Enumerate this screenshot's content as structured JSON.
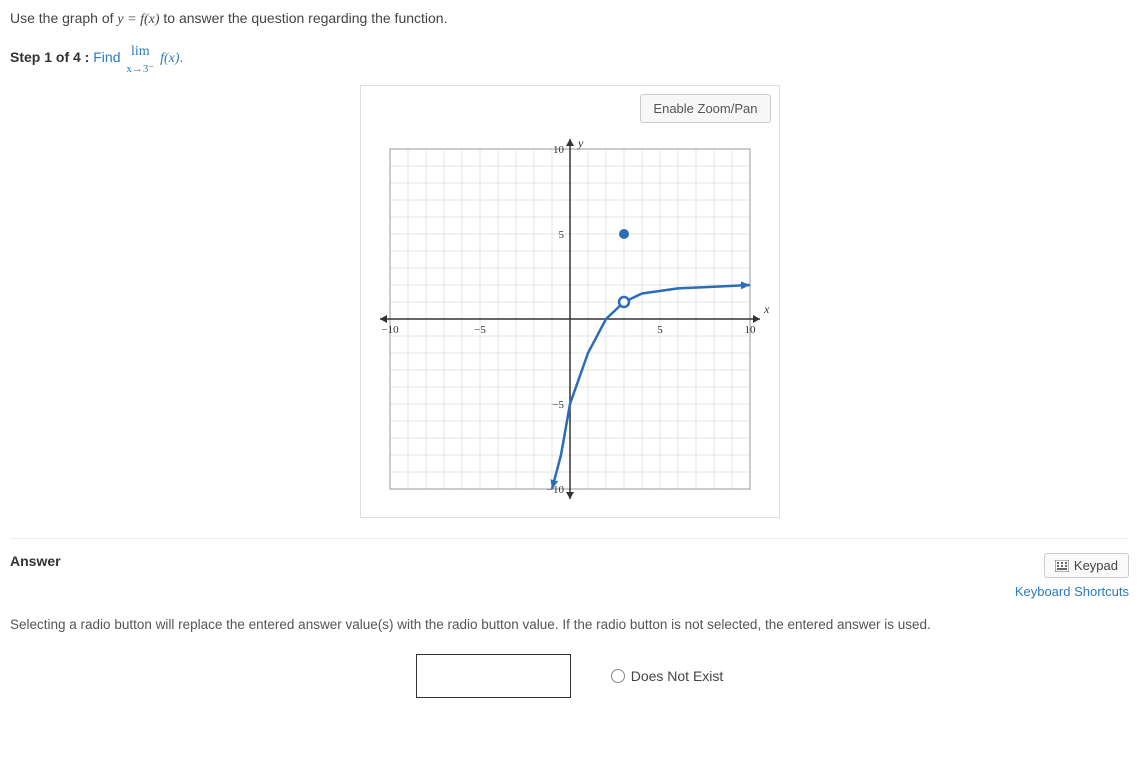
{
  "instruction": {
    "prefix": "Use the graph of ",
    "eq_lhs": "y",
    "eq_mid": " = ",
    "eq_rhs": "f(x)",
    "suffix": " to answer the question regarding the function."
  },
  "step": {
    "label": "Step 1 of 4 :",
    "task_prefix": "Find ",
    "limit_top": "lim",
    "limit_bottom": "x→3⁻",
    "func": "f(x)",
    "period": "."
  },
  "graph": {
    "zoom_button": "Enable Zoom/Pan"
  },
  "chart_data": {
    "type": "line",
    "title": "",
    "xlabel": "x",
    "ylabel": "y",
    "xlim": [
      -10,
      10
    ],
    "ylim": [
      -10,
      10
    ],
    "xticks": [
      -10,
      -5,
      5,
      10
    ],
    "yticks": [
      -10,
      -5,
      5,
      10
    ],
    "series": [
      {
        "name": "f(x)",
        "points": [
          {
            "x": -1,
            "y": -10
          },
          {
            "x": -0.5,
            "y": -8
          },
          {
            "x": 0,
            "y": -5
          },
          {
            "x": 1,
            "y": -2
          },
          {
            "x": 2,
            "y": 0
          },
          {
            "x": 3,
            "y": 1,
            "open": true
          },
          {
            "x": 4,
            "y": 1.5
          },
          {
            "x": 6,
            "y": 1.8
          },
          {
            "x": 8,
            "y": 1.9
          },
          {
            "x": 10,
            "y": 2
          }
        ]
      }
    ],
    "points": [
      {
        "x": 3,
        "y": 5,
        "filled": true
      }
    ]
  },
  "answer": {
    "heading": "Answer",
    "keypad": "Keypad",
    "shortcuts": "Keyboard Shortcuts",
    "hint": "Selecting a radio button will replace the entered answer value(s) with the radio button value. If the radio button is not selected, the entered answer is used.",
    "input_value": "",
    "dne_label": "Does Not Exist"
  }
}
